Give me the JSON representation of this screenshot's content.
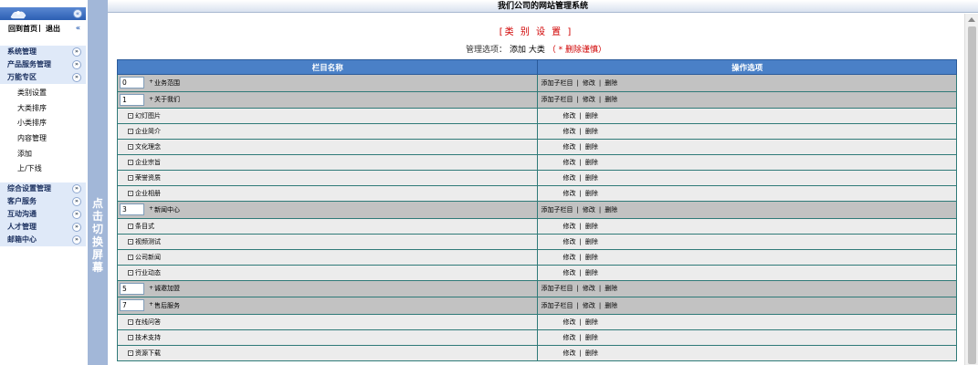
{
  "sidebar": {
    "toggle_glyph": "«",
    "collapse_glyph": "«",
    "home_link": "回到首页",
    "separator": "|",
    "logout_link": "退出",
    "menu_top": [
      {
        "label": "系统管理"
      },
      {
        "label": "产品服务管理"
      },
      {
        "label": "万能专区"
      }
    ],
    "submenu": [
      "类别设置",
      "大类排序",
      "小类排序",
      "内容管理",
      "添加",
      "上/下线"
    ],
    "menu_bottom": [
      {
        "label": "综合设置管理"
      },
      {
        "label": "客户服务"
      },
      {
        "label": "互动沟通"
      },
      {
        "label": "人才管理"
      },
      {
        "label": "邮箱中心"
      }
    ],
    "chevron_glyph": "»",
    "colors": {
      "menu_bg": "#dfe9f8",
      "logo_bar": "#2c5fb3"
    }
  },
  "switch_bar": {
    "text": "点击切换屏幕",
    "color": "#a2b7d8"
  },
  "main": {
    "header_title": "我们公司的网站管理系统",
    "section_title": "[类 别 设 置 ]",
    "mgmt_prefix": "管理选项：",
    "mgmt_add": "添加",
    "mgmt_big": "大类",
    "mgmt_warning": "（ * 删除谨慎）",
    "table": {
      "headers": [
        "栏目名称",
        "操作选项"
      ],
      "op_add_child": "添加子栏目",
      "op_edit": "修改",
      "op_delete": "删除",
      "op_sep": "|",
      "plus_glyph": "+",
      "minus_glyph": "-",
      "rows": [
        {
          "type": "main",
          "order": "0",
          "name": "业务范围"
        },
        {
          "type": "main",
          "order": "1",
          "name": "关于我们"
        },
        {
          "type": "sub",
          "name": "幻灯图片"
        },
        {
          "type": "sub",
          "name": "企业简介"
        },
        {
          "type": "sub",
          "name": "文化理念"
        },
        {
          "type": "sub",
          "name": "企业宗旨"
        },
        {
          "type": "sub",
          "name": "荣誉资质"
        },
        {
          "type": "sub",
          "name": "企业相册"
        },
        {
          "type": "main",
          "order": "3",
          "name": "新闻中心"
        },
        {
          "type": "sub",
          "name": "条目式"
        },
        {
          "type": "sub",
          "name": "视频测试"
        },
        {
          "type": "sub",
          "name": "公司新闻"
        },
        {
          "type": "sub",
          "name": "行业动态"
        },
        {
          "type": "main",
          "order": "5",
          "name": "诚邀加盟"
        },
        {
          "type": "main",
          "order": "7",
          "name": "售后服务"
        },
        {
          "type": "sub",
          "name": "在线问答"
        },
        {
          "type": "sub",
          "name": "技术支持"
        },
        {
          "type": "sub",
          "name": "资源下载"
        }
      ]
    },
    "colors": {
      "header_row": "#4a80c7",
      "main_row": "#c2c2c2",
      "sub_row": "#ececec",
      "title_red": "#d00000"
    }
  }
}
